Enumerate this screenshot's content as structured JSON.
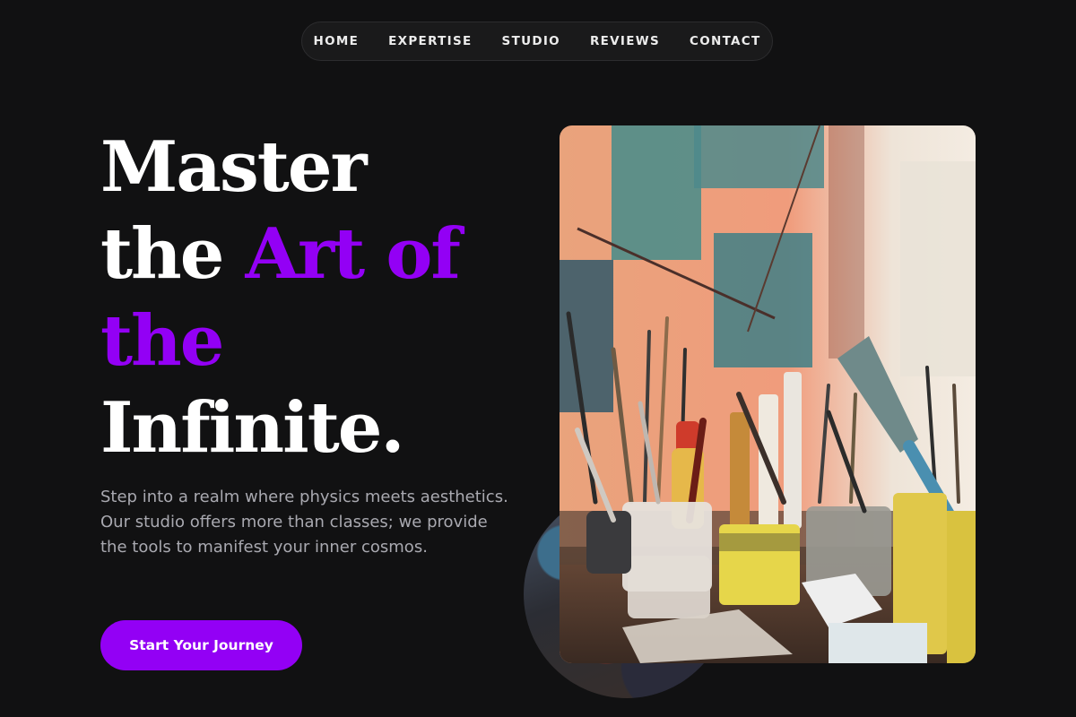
{
  "nav": {
    "items": [
      {
        "label": "HOME"
      },
      {
        "label": "EXPERTISE"
      },
      {
        "label": "STUDIO"
      },
      {
        "label": "REVIEWS"
      },
      {
        "label": "CONTACT"
      }
    ]
  },
  "hero": {
    "headline": {
      "line1": "Master",
      "line2_plain": "the ",
      "line2_accent": "Art of",
      "line3_accent": "the",
      "line4": "Infinite."
    },
    "description": "Step into a realm where physics meets aesthetics. Our studio offers more than classes; we provide the tools to manifest your inner cosmos.",
    "cta_label": "Start Your Journey"
  },
  "colors": {
    "background": "#111112",
    "accent": "#9300f5",
    "text": "#ffffff",
    "muted": "#a9a9b0"
  }
}
